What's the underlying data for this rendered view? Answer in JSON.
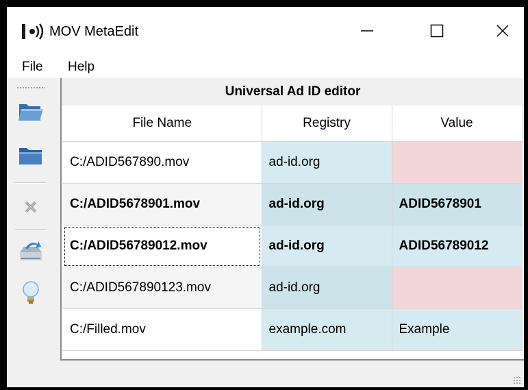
{
  "window": {
    "title": "MOV MetaEdit",
    "controls": {
      "minimize": "minimize-icon",
      "maximize": "maximize-icon",
      "close": "close-icon"
    }
  },
  "menu": {
    "file": "File",
    "help": "Help"
  },
  "toolbar": {
    "items": [
      "open-file-icon",
      "open-folder-icon",
      "close-file-icon",
      "save-icon",
      "help-icon"
    ]
  },
  "panel": {
    "title": "Universal Ad ID editor"
  },
  "table": {
    "headers": {
      "file_name": "File Name",
      "registry": "Registry",
      "value": "Value"
    },
    "rows": [
      {
        "file_name": "C:/ADID567890.mov",
        "registry": "ad-id.org",
        "value": "",
        "bold": false,
        "value_status": "error"
      },
      {
        "file_name": "C:/ADID5678901.mov",
        "registry": "ad-id.org",
        "value": "ADID5678901",
        "bold": true,
        "value_status": "ok"
      },
      {
        "file_name": "C:/ADID56789012.mov",
        "registry": "ad-id.org",
        "value": "ADID56789012",
        "bold": true,
        "value_status": "ok"
      },
      {
        "file_name": "C:/ADID567890123.mov",
        "registry": "ad-id.org",
        "value": "",
        "bold": false,
        "value_status": "error"
      },
      {
        "file_name": "C:/Filled.mov",
        "registry": "example.com",
        "value": "Example",
        "bold": false,
        "value_status": "ok"
      }
    ]
  },
  "colors": {
    "valid_cell": "#d6eaf1",
    "error_cell": "#f2d6d8",
    "window_bg": "#f0f0f0"
  }
}
